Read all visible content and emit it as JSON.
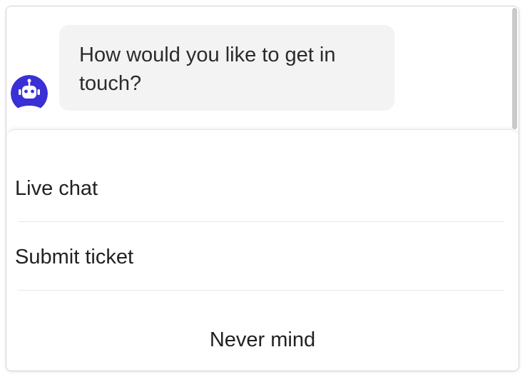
{
  "chat": {
    "message": "How would you like to get in touch?",
    "avatar_icon": "robot-icon",
    "avatar_color": "#3b2fd6"
  },
  "options": {
    "live_chat": "Live chat",
    "submit_ticket": "Submit ticket",
    "cancel": "Never mind"
  }
}
